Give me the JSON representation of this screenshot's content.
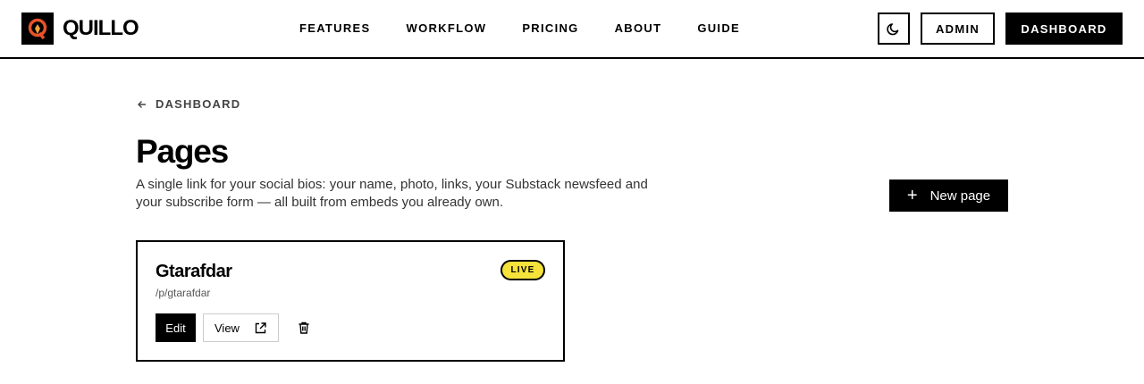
{
  "header": {
    "brand": "QUILLO",
    "nav": [
      "FEATURES",
      "WORKFLOW",
      "PRICING",
      "ABOUT",
      "GUIDE"
    ],
    "admin_label": "ADMIN",
    "dashboard_label": "DASHBOARD",
    "icons": {
      "logo": "quillo-logo",
      "theme": "moon-icon"
    }
  },
  "main": {
    "back_label": "DASHBOARD",
    "title": "Pages",
    "description": "A single link for your social bios: your name, photo, links, your Substack newsfeed and your subscribe form — all built from embeds you already own.",
    "new_page_label": "New page"
  },
  "pages": [
    {
      "name": "Gtarafdar",
      "path": "/p/gtarafdar",
      "status": "LIVE",
      "edit_label": "Edit",
      "view_label": "View"
    }
  ],
  "colors": {
    "accent": "#000000",
    "live_badge": "#f5e23b",
    "logo_q": "#e8522a"
  }
}
